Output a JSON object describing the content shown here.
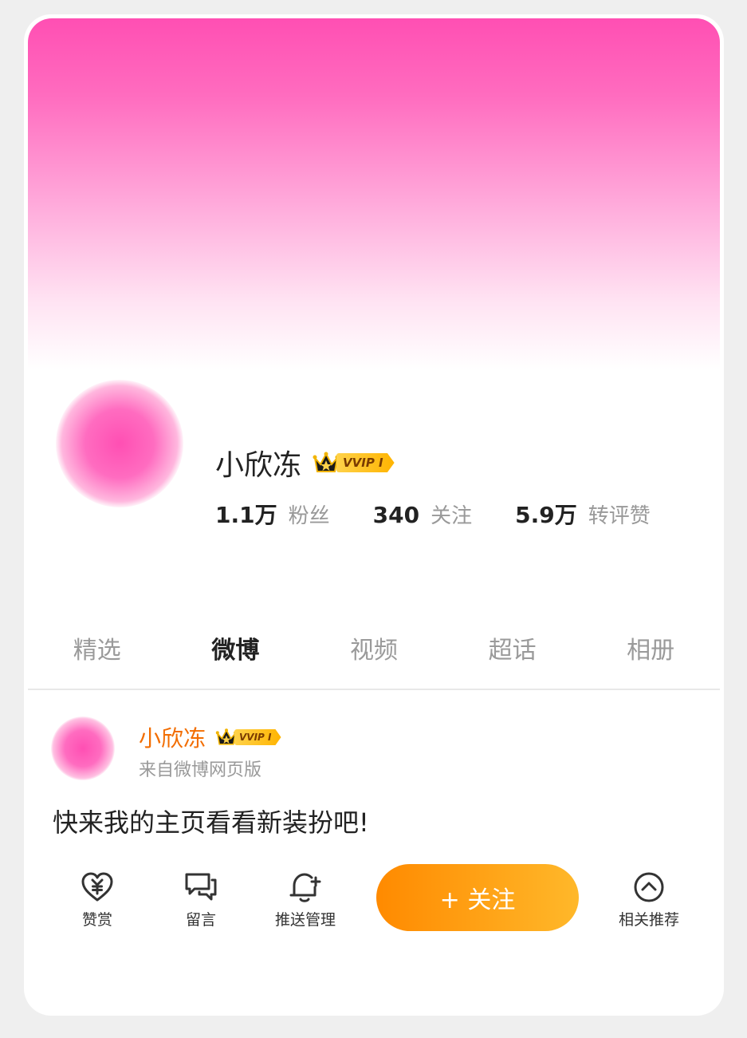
{
  "profile": {
    "name": "小欣冻",
    "vip_badge": "VVIP I",
    "stats": [
      {
        "value": "1.1万",
        "label": "粉丝"
      },
      {
        "value": "340",
        "label": "关注"
      },
      {
        "value": "5.9万",
        "label": "转评赞"
      }
    ]
  },
  "tabs": [
    {
      "label": "精选"
    },
    {
      "label": "微博"
    },
    {
      "label": "视频"
    },
    {
      "label": "超话"
    },
    {
      "label": "相册"
    }
  ],
  "active_tab": "微博",
  "post": {
    "author": "小欣冻",
    "vip_badge": "VVIP I",
    "source": "来自微博网页版",
    "text": "快来我的主页看看新装扮吧!"
  },
  "actions": {
    "reward_label": "赞赏",
    "comment_label": "留言",
    "push_label": "推送管理",
    "follow_label": "+ 关注",
    "related_label": "相关推荐"
  },
  "colors": {
    "cover_top": "#ff4fb3",
    "author_name": "#f26d00",
    "follow_button_start": "#ff8a00",
    "follow_button_end": "#ffb82a"
  }
}
